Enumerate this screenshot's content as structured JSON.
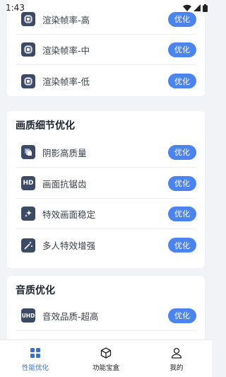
{
  "status": {
    "time": "1:43"
  },
  "cards": [
    {
      "title": "",
      "items": [
        {
          "label": "渲染帧率-高",
          "icon": "chip-icon",
          "button": "优化"
        },
        {
          "label": "渲染帧率-中",
          "icon": "chip-icon",
          "button": "优化"
        },
        {
          "label": "渲染帧率-低",
          "icon": "chip-icon",
          "button": "优化"
        }
      ]
    },
    {
      "title": "画质细节优化",
      "items": [
        {
          "label": "阴影高质量",
          "icon": "shadow-layers-icon",
          "button": "优化"
        },
        {
          "label": "画面抗锯齿",
          "icon": "hd-icon",
          "icon_text": "HD",
          "button": "优化"
        },
        {
          "label": "特效画面稳定",
          "icon": "sparkle-icon",
          "button": "优化"
        },
        {
          "label": "多人特效增强",
          "icon": "magic-wand-icon",
          "button": "优化"
        }
      ]
    },
    {
      "title": "音质优化",
      "items": [
        {
          "label": "音效品质-超高",
          "icon": "uhd-icon",
          "icon_text": "UHD",
          "button": "优化"
        }
      ]
    }
  ],
  "tabbar": {
    "items": [
      {
        "label": "性能优化",
        "icon": "grid-icon",
        "active": true
      },
      {
        "label": "功能宝盒",
        "icon": "box-icon",
        "active": false
      },
      {
        "label": "我的",
        "icon": "user-icon",
        "active": false
      }
    ]
  },
  "colors": {
    "accent": "#4b84ec",
    "icon_bg": "#3c4a66",
    "active_tab": "#3b6fd8"
  }
}
